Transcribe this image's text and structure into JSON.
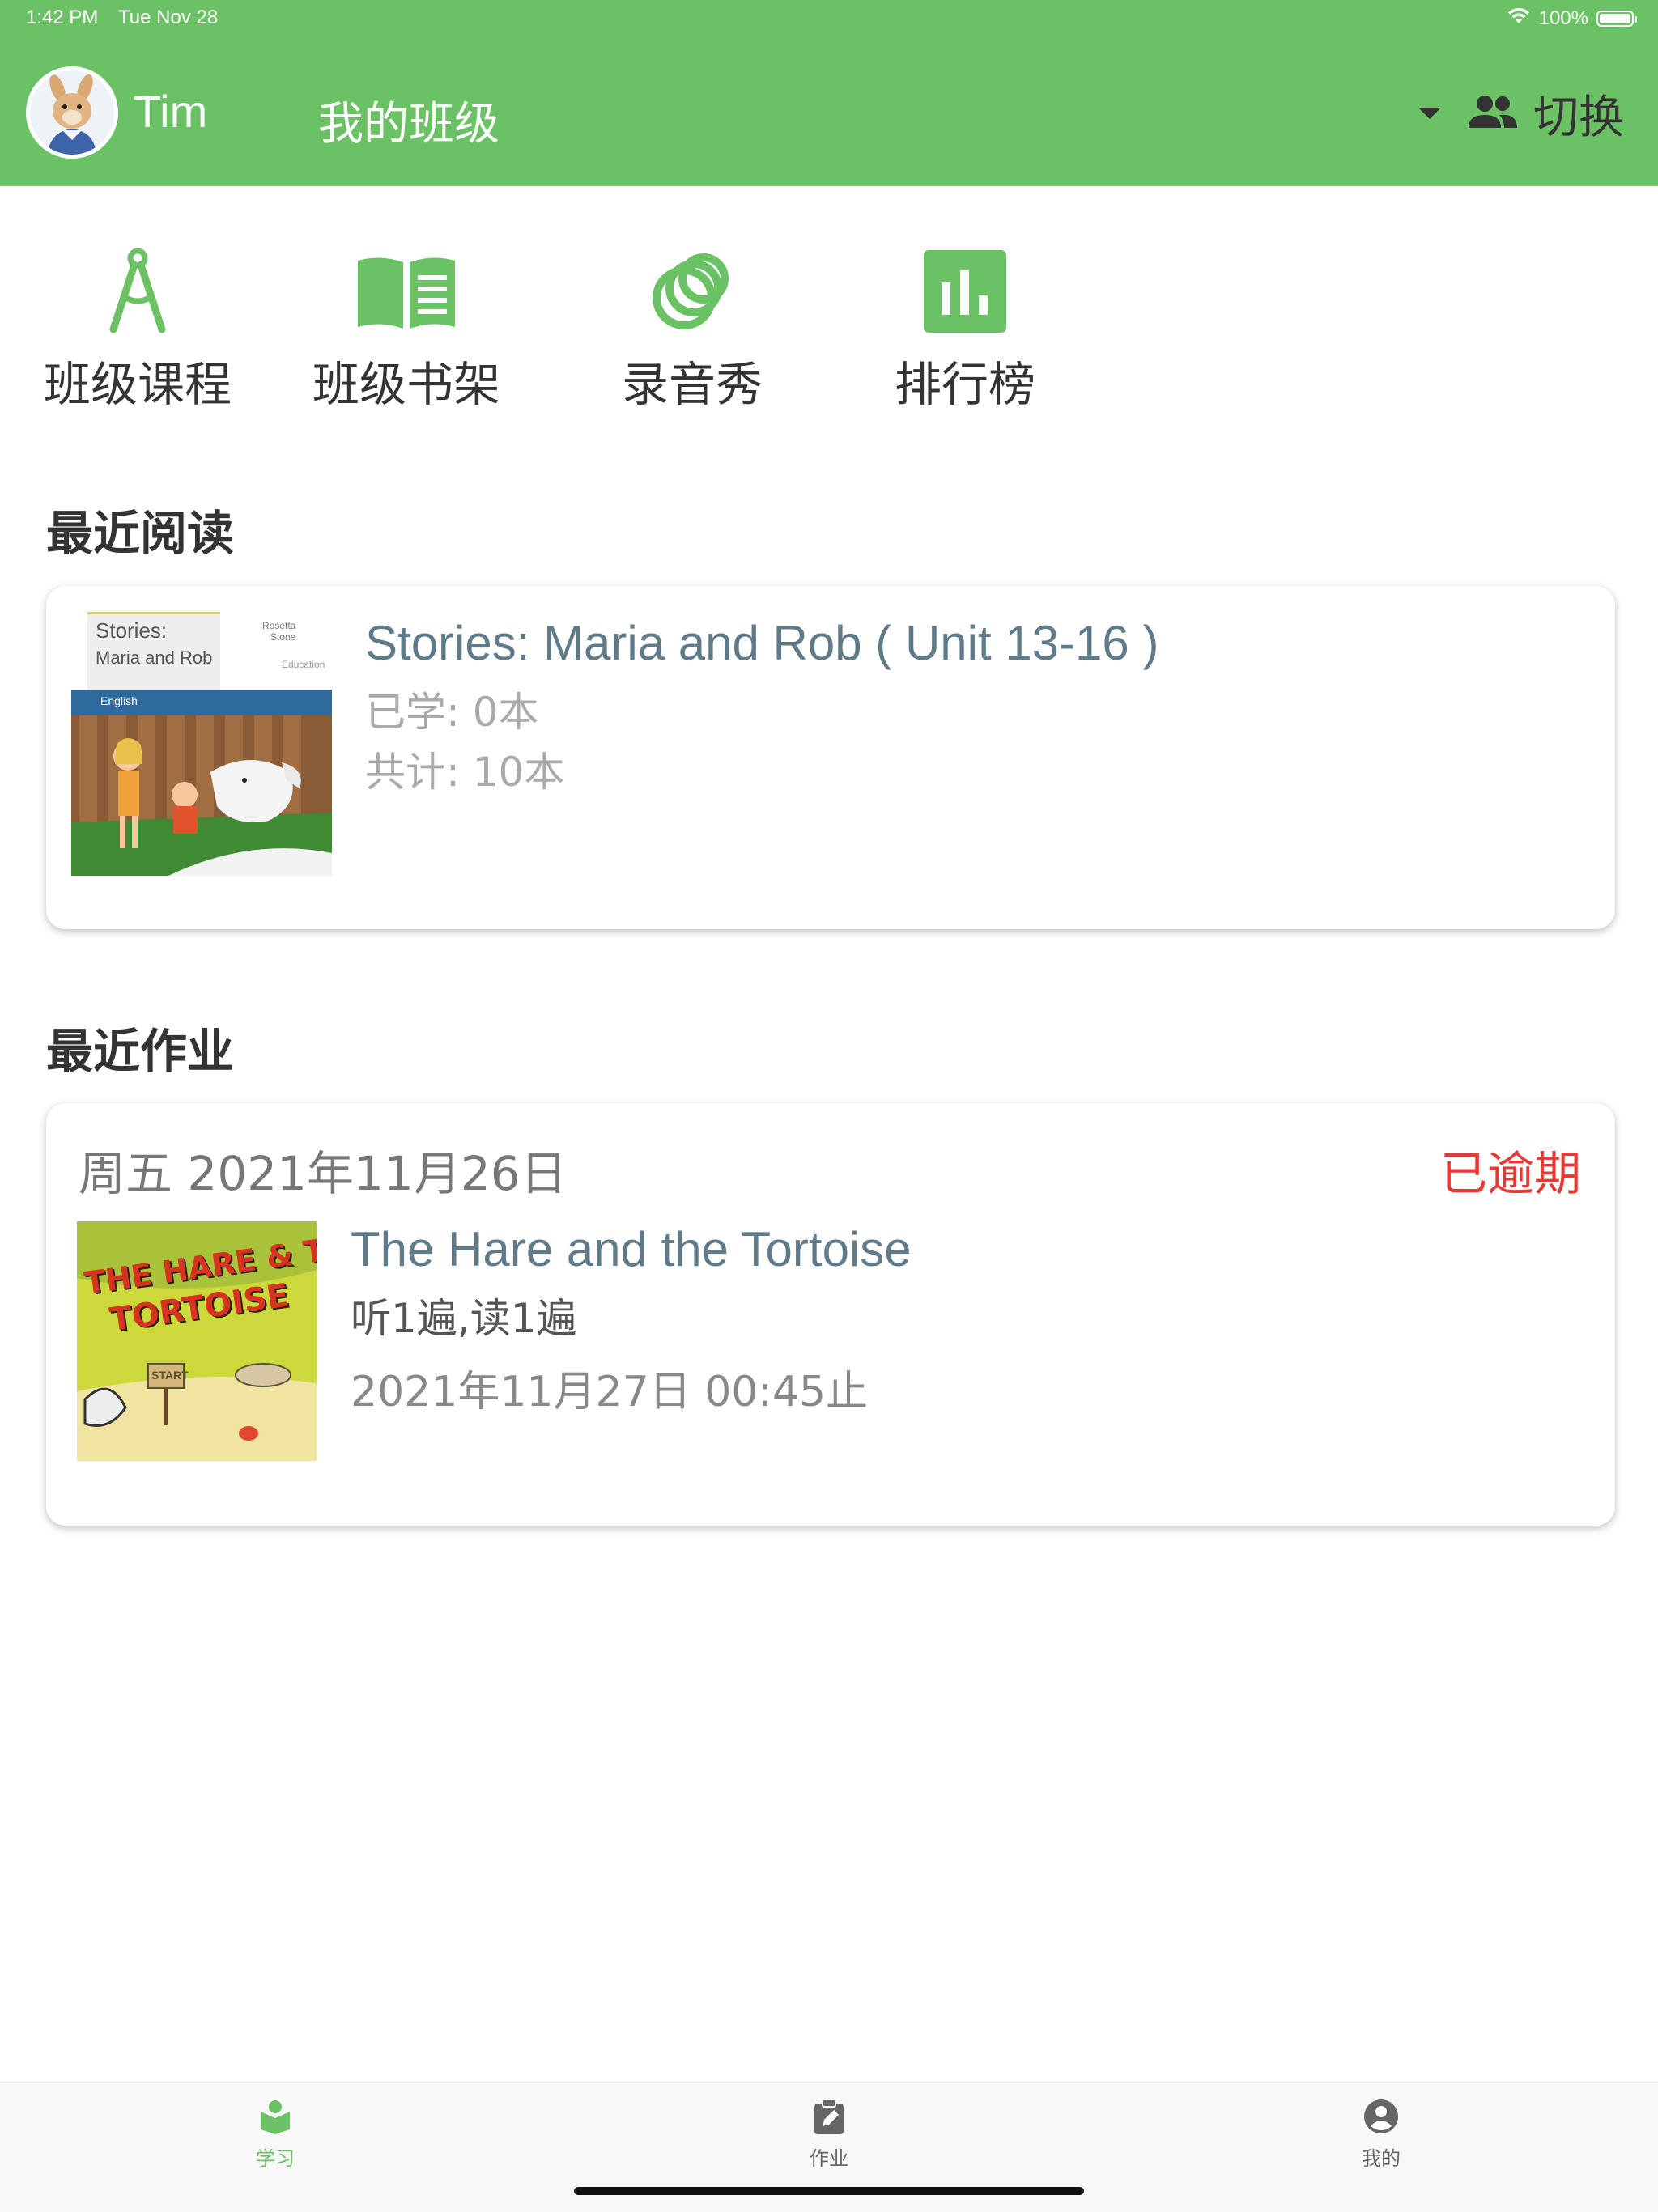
{
  "status_bar": {
    "time": "1:42 PM",
    "date": "Tue Nov 28",
    "battery": "100%",
    "battery_level": 1.0
  },
  "header": {
    "user_name": "Tim",
    "title": "我的班级",
    "switch_label": "切换",
    "brand_color": "#6bc264"
  },
  "quick_menu": [
    {
      "label": "班级课程",
      "icon": "compass-icon"
    },
    {
      "label": "班级书架",
      "icon": "book-icon"
    },
    {
      "label": "录音秀",
      "icon": "rings-icon"
    },
    {
      "label": "排行榜",
      "icon": "bar-chart-icon"
    }
  ],
  "recent_reading": {
    "section_title": "最近阅读",
    "book": {
      "cover_lines": [
        "Stories:",
        "Maria and Rob"
      ],
      "cover_publisher": [
        "Rosetta",
        "Stone",
        "Education"
      ],
      "cover_strip": "English",
      "title": "Stories: Maria and Rob ( Unit 13-16 )",
      "learned": "已学: 0本",
      "total": "共计: 10本"
    }
  },
  "recent_homework": {
    "section_title": "最近作业",
    "item": {
      "date": "周五 2021年11月26日",
      "status": "已逾期",
      "status_color": "#e53935",
      "cover_text": [
        "THE HARE & THE",
        "TORTOISE"
      ],
      "cover_sign": "START",
      "title": "The Hare and the Tortoise",
      "task": "听1遍,读1遍",
      "deadline": "2021年11月27日 00:45止"
    }
  },
  "tabbar": [
    {
      "label": "学习",
      "icon": "study-icon",
      "active": true
    },
    {
      "label": "作业",
      "icon": "homework-icon",
      "active": false
    },
    {
      "label": "我的",
      "icon": "profile-icon",
      "active": false
    }
  ]
}
